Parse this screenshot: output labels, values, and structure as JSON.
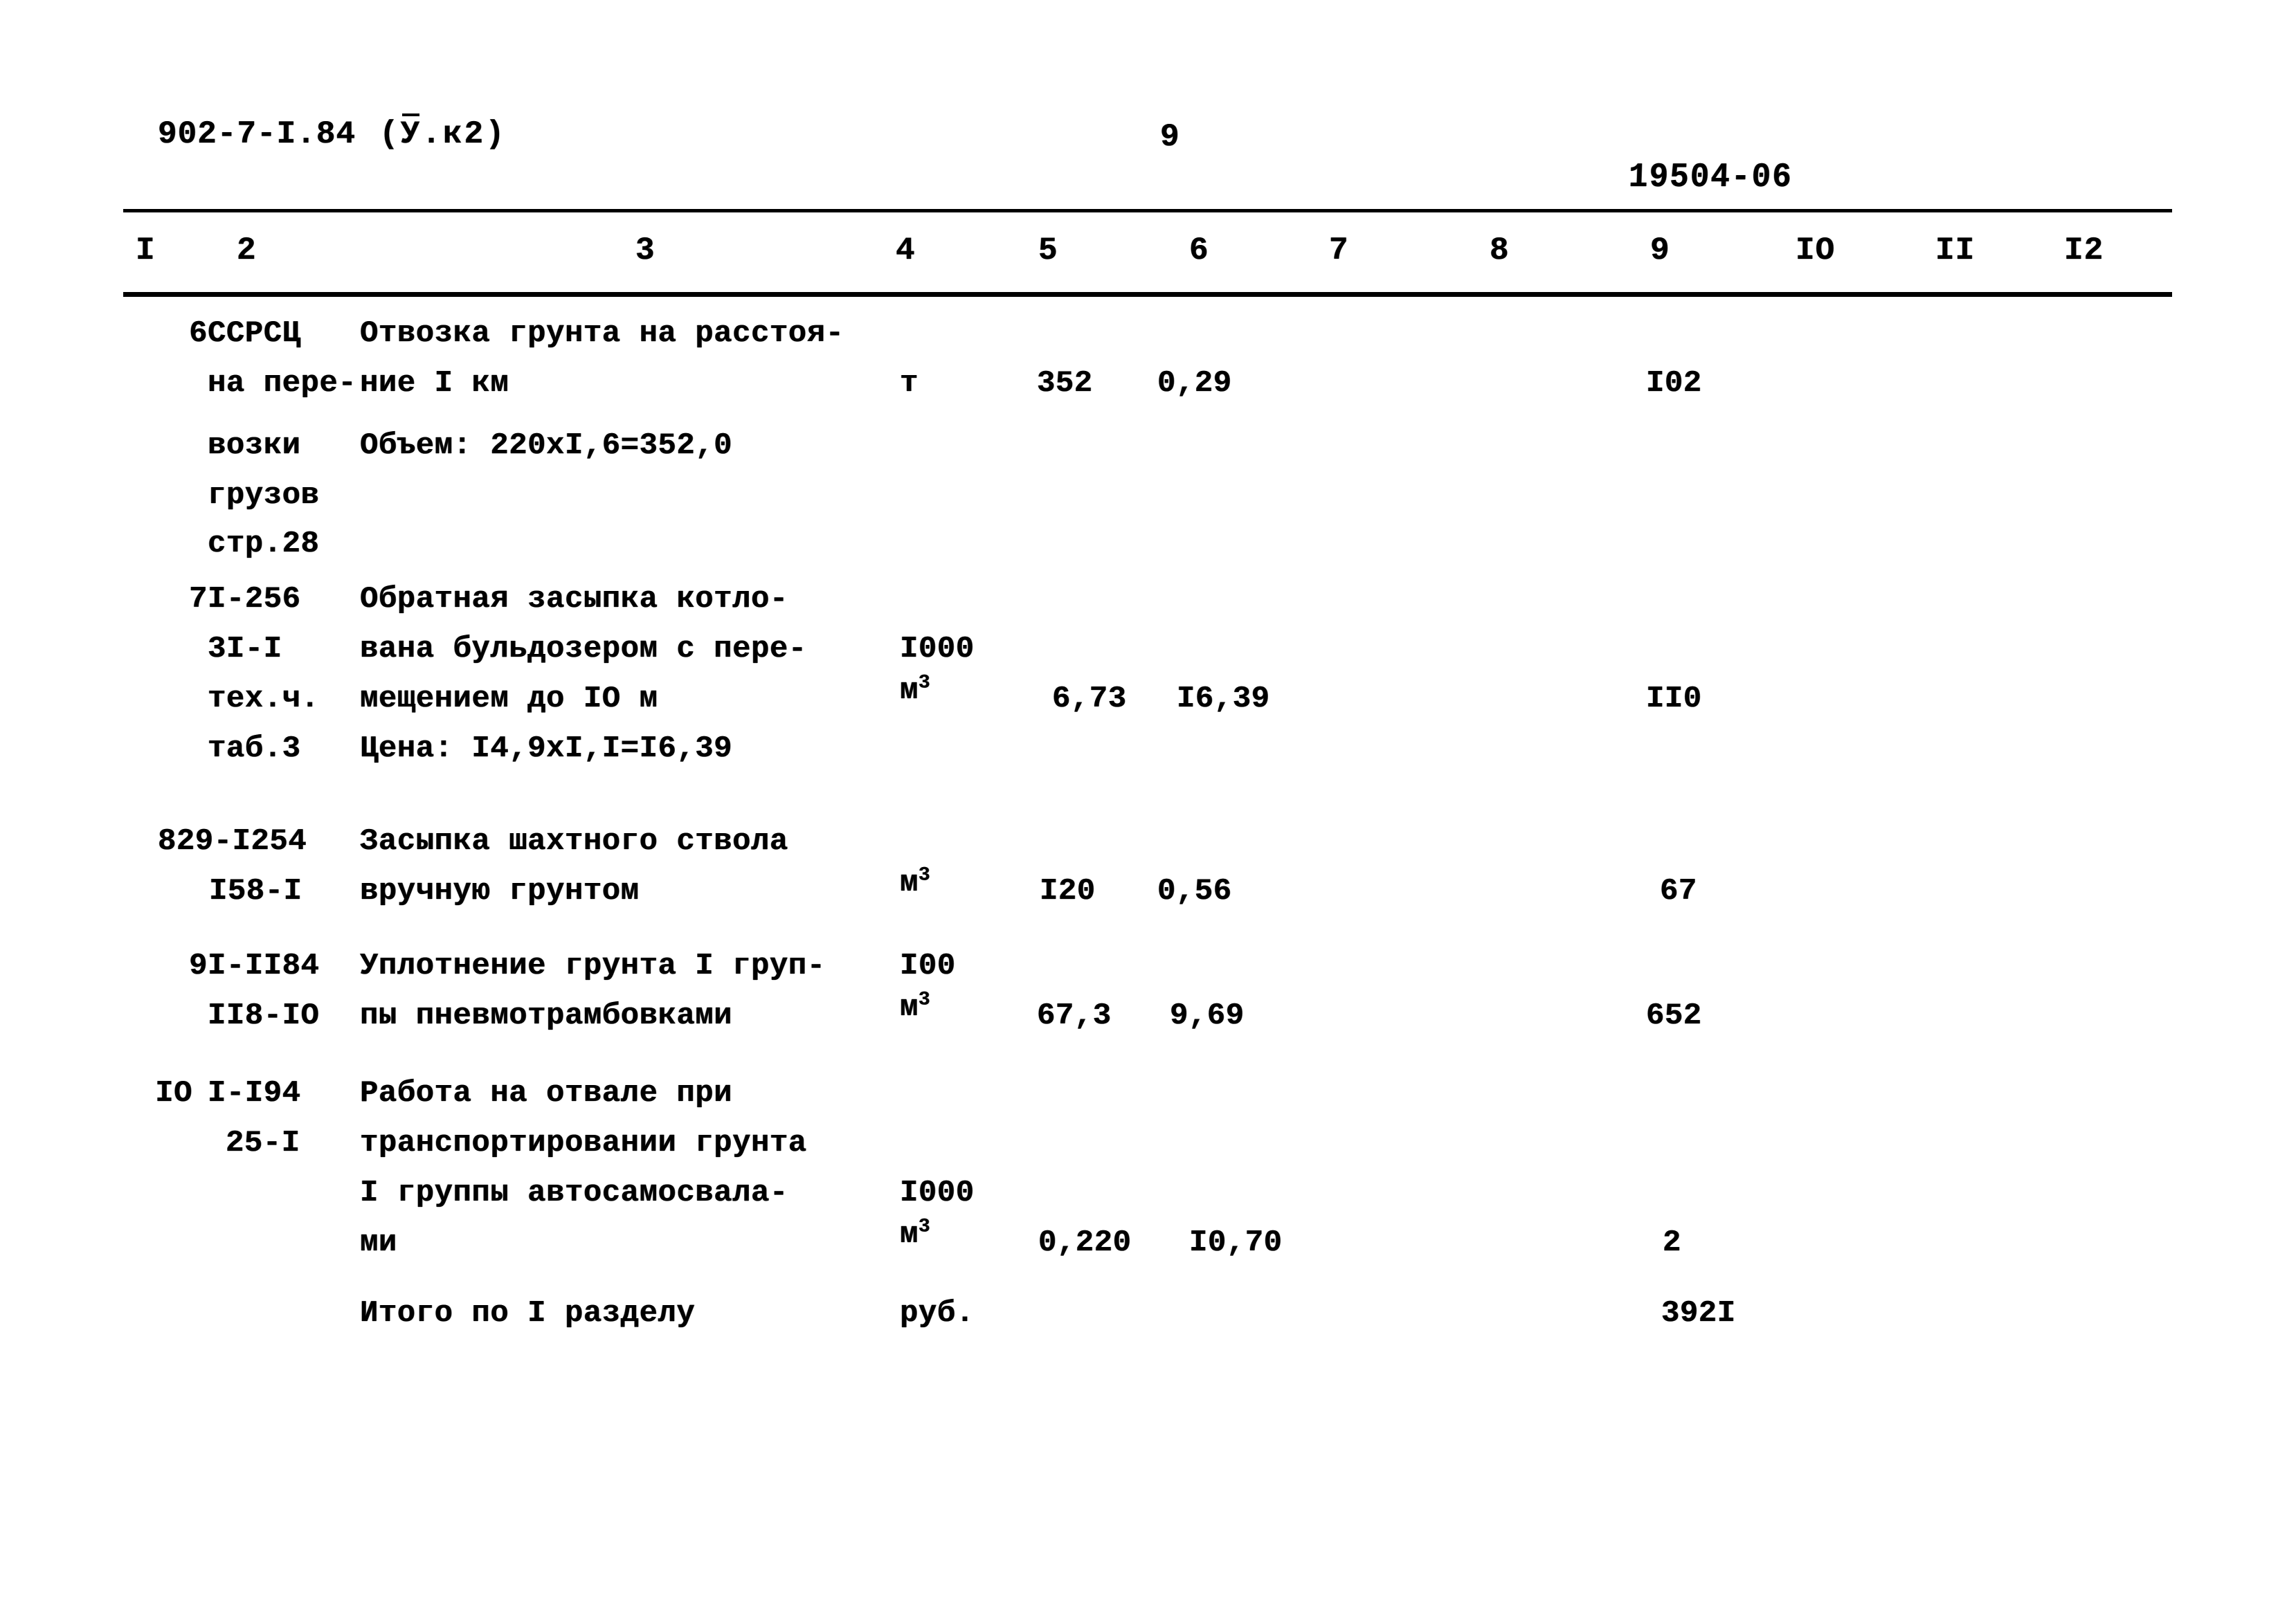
{
  "header": {
    "doc_code": "902-7-I.84",
    "variant_open": "(",
    "variant_letter": "У",
    "variant_rest": ".к2)",
    "page_number": "9",
    "stamp_number": "19504-06"
  },
  "table": {
    "column_numbers": [
      "I",
      "2",
      "3",
      "4",
      "5",
      "6",
      "7",
      "8",
      "9",
      "IO",
      "II",
      "I2"
    ],
    "rows": [
      {
        "pos": "6",
        "code_lines": [
          "ССРСЦ",
          "на пере-",
          "возки",
          "грузов",
          "стр.28"
        ],
        "desc_lines": [
          "Отвозка грунта на расстоя-",
          "ние I км",
          "",
          "Объем: 220xI,6=352,0"
        ],
        "unit": "т",
        "unit_sup": "",
        "qty": "352",
        "price": "0,29",
        "cost": "I02"
      },
      {
        "pos": "7",
        "code_lines": [
          "I-256",
          "3I-I",
          "тех.ч.",
          "таб.3"
        ],
        "desc_lines": [
          "Обратная засыпка котло-",
          "вана бульдозером с пере-",
          "мещением до IO м",
          "Цена: I4,9xI,I=I6,39"
        ],
        "unit": "I000",
        "unit_sup": "м3",
        "qty": "6,73",
        "price": "I6,39",
        "cost": "II0"
      },
      {
        "pos": "",
        "code_lines": [
          "829-I254",
          "I58-I"
        ],
        "desc_lines": [
          "Засыпка шахтного ствола",
          "вручную грунтом"
        ],
        "unit": "",
        "unit_sup": "м3",
        "qty": "I20",
        "price": "0,56",
        "cost": "67"
      },
      {
        "pos": "9",
        "code_lines": [
          "I-II84",
          "II8-IO"
        ],
        "desc_lines": [
          "Уплотнение грунта I груп-",
          "пы пневмотрамбовками"
        ],
        "unit": "I00",
        "unit_sup": "м3",
        "qty": "67,3",
        "price": "9,69",
        "cost": "652"
      },
      {
        "pos": "IO",
        "code_lines": [
          "I-I94",
          "25-I"
        ],
        "desc_lines": [
          "Работа на отвале при",
          "транспортировании грунта",
          "I группы автосамосвала-",
          "ми"
        ],
        "unit": "I000",
        "unit_sup": "м3",
        "qty": "0,220",
        "price": "I0,70",
        "cost": "2"
      }
    ],
    "total": {
      "label": "Итого по I разделу",
      "unit": "руб.",
      "cost": "392I"
    }
  }
}
